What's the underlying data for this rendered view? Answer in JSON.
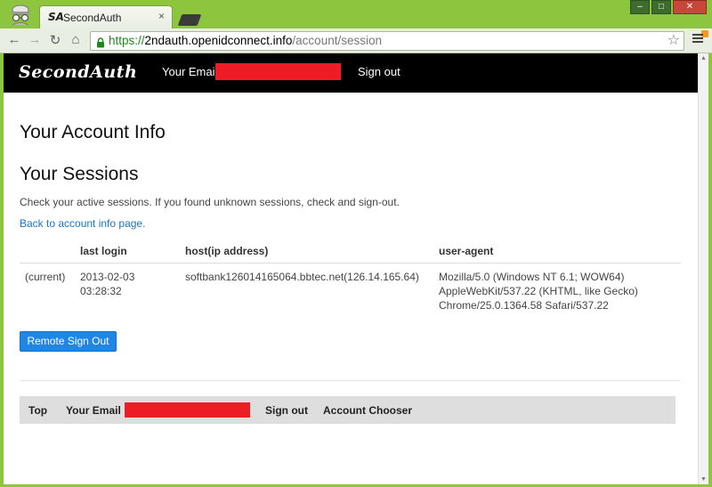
{
  "browser": {
    "tab_logo": "SA",
    "tab_title": "SecondAuth",
    "tab_close": "×",
    "url_scheme": "https://",
    "url_host": "2ndauth.openidconnect.info",
    "url_path": "/account/session",
    "window_minimize": "–",
    "window_maximize": "□",
    "window_close": "✕",
    "back_glyph": "←",
    "forward_glyph": "→",
    "reload_glyph": "↻",
    "home_glyph": "⌂",
    "star_glyph": "☆"
  },
  "navbar": {
    "brand": "SecondAuth",
    "email_label": "Your Email",
    "signout": "Sign out"
  },
  "main": {
    "account_title": "Your Account Info",
    "sessions_title": "Your Sessions",
    "description": "Check your active sessions. If you found unknown sessions, check and sign-out.",
    "back_link": "Back to account info page.",
    "table": {
      "headers": [
        "",
        "last login",
        "host(ip address)",
        "user-agent"
      ],
      "rows": [
        {
          "status": "(current)",
          "last_login_date": "2013-02-03",
          "last_login_time": "03:28:32",
          "host": "softbank126014165064.bbtec.net(126.14.165.64)",
          "user_agent_1": "Mozilla/5.0 (Windows NT 6.1; WOW64)",
          "user_agent_2": "AppleWebKit/537.22 (KHTML, like Gecko)",
          "user_agent_3": "Chrome/25.0.1364.58 Safari/537.22"
        }
      ]
    },
    "remote_signout_button": "Remote Sign Out"
  },
  "footer": {
    "top": "Top",
    "email_label": "Your Email :",
    "signout": "Sign out",
    "account_chooser": "Account Chooser"
  },
  "colors": {
    "chrome": "#8dc63e",
    "navbar": "#000000",
    "redaction": "#ee1c25",
    "link": "#1b76c7",
    "button": "#1e87e5"
  }
}
